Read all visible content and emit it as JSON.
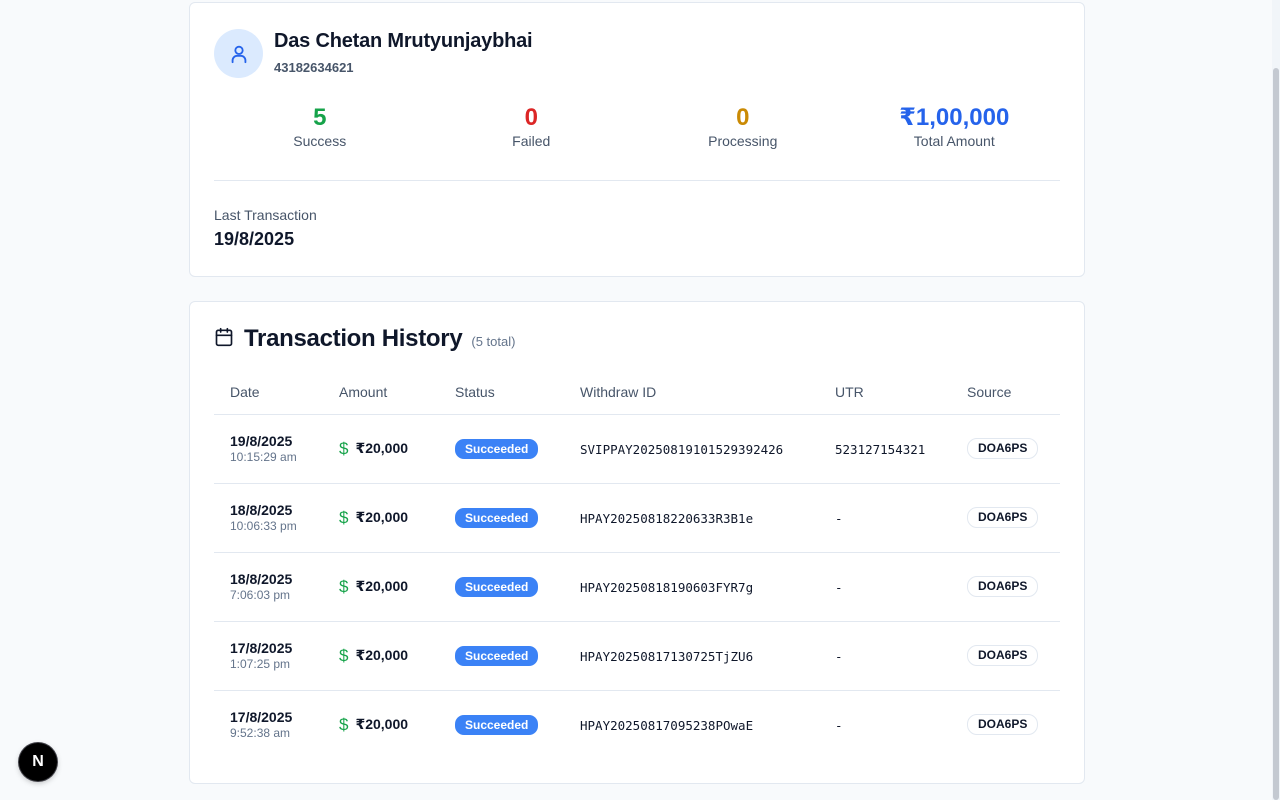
{
  "profile": {
    "name": "Das Chetan Mrutyunjaybhai",
    "account_id": "43182634621",
    "stats": [
      {
        "key": "success",
        "value": "5",
        "label": "Success",
        "color": "#16a34a"
      },
      {
        "key": "failed",
        "value": "0",
        "label": "Failed",
        "color": "#dc2626"
      },
      {
        "key": "processing",
        "value": "0",
        "label": "Processing",
        "color": "#ca8a04"
      },
      {
        "key": "total",
        "value": "₹1,00,000",
        "label": "Total Amount",
        "color": "#2563eb"
      }
    ],
    "last_transaction_label": "Last Transaction",
    "last_transaction_value": "19/8/2025"
  },
  "history": {
    "title": "Transaction History",
    "count": "(5 total)",
    "columns": [
      "Date",
      "Amount",
      "Status",
      "Withdraw ID",
      "UTR",
      "Source"
    ],
    "rows": [
      {
        "date": "19/8/2025",
        "time": "10:15:29 am",
        "amount": "₹20,000",
        "status": "Succeeded",
        "withdraw_id": "SVIPPAY20250819101529392426",
        "utr": "523127154321",
        "source": "DOA6PS"
      },
      {
        "date": "18/8/2025",
        "time": "10:06:33 pm",
        "amount": "₹20,000",
        "status": "Succeeded",
        "withdraw_id": "HPAY20250818220633R3B1e",
        "utr": "-",
        "source": "DOA6PS"
      },
      {
        "date": "18/8/2025",
        "time": "7:06:03 pm",
        "amount": "₹20,000",
        "status": "Succeeded",
        "withdraw_id": "HPAY20250818190603FYR7g",
        "utr": "-",
        "source": "DOA6PS"
      },
      {
        "date": "17/8/2025",
        "time": "1:07:25 pm",
        "amount": "₹20,000",
        "status": "Succeeded",
        "withdraw_id": "HPAY20250817130725TjZU6",
        "utr": "-",
        "source": "DOA6PS"
      },
      {
        "date": "17/8/2025",
        "time": "9:52:38 am",
        "amount": "₹20,000",
        "status": "Succeeded",
        "withdraw_id": "HPAY20250817095238POwaE",
        "utr": "-",
        "source": "DOA6PS"
      }
    ]
  },
  "icons": {
    "avatar": "user-icon",
    "history": "calendar-icon",
    "amount": "dollar-icon",
    "fab": "nextjs-logo-icon"
  },
  "fab_label": "N",
  "dollar_glyph": "$"
}
